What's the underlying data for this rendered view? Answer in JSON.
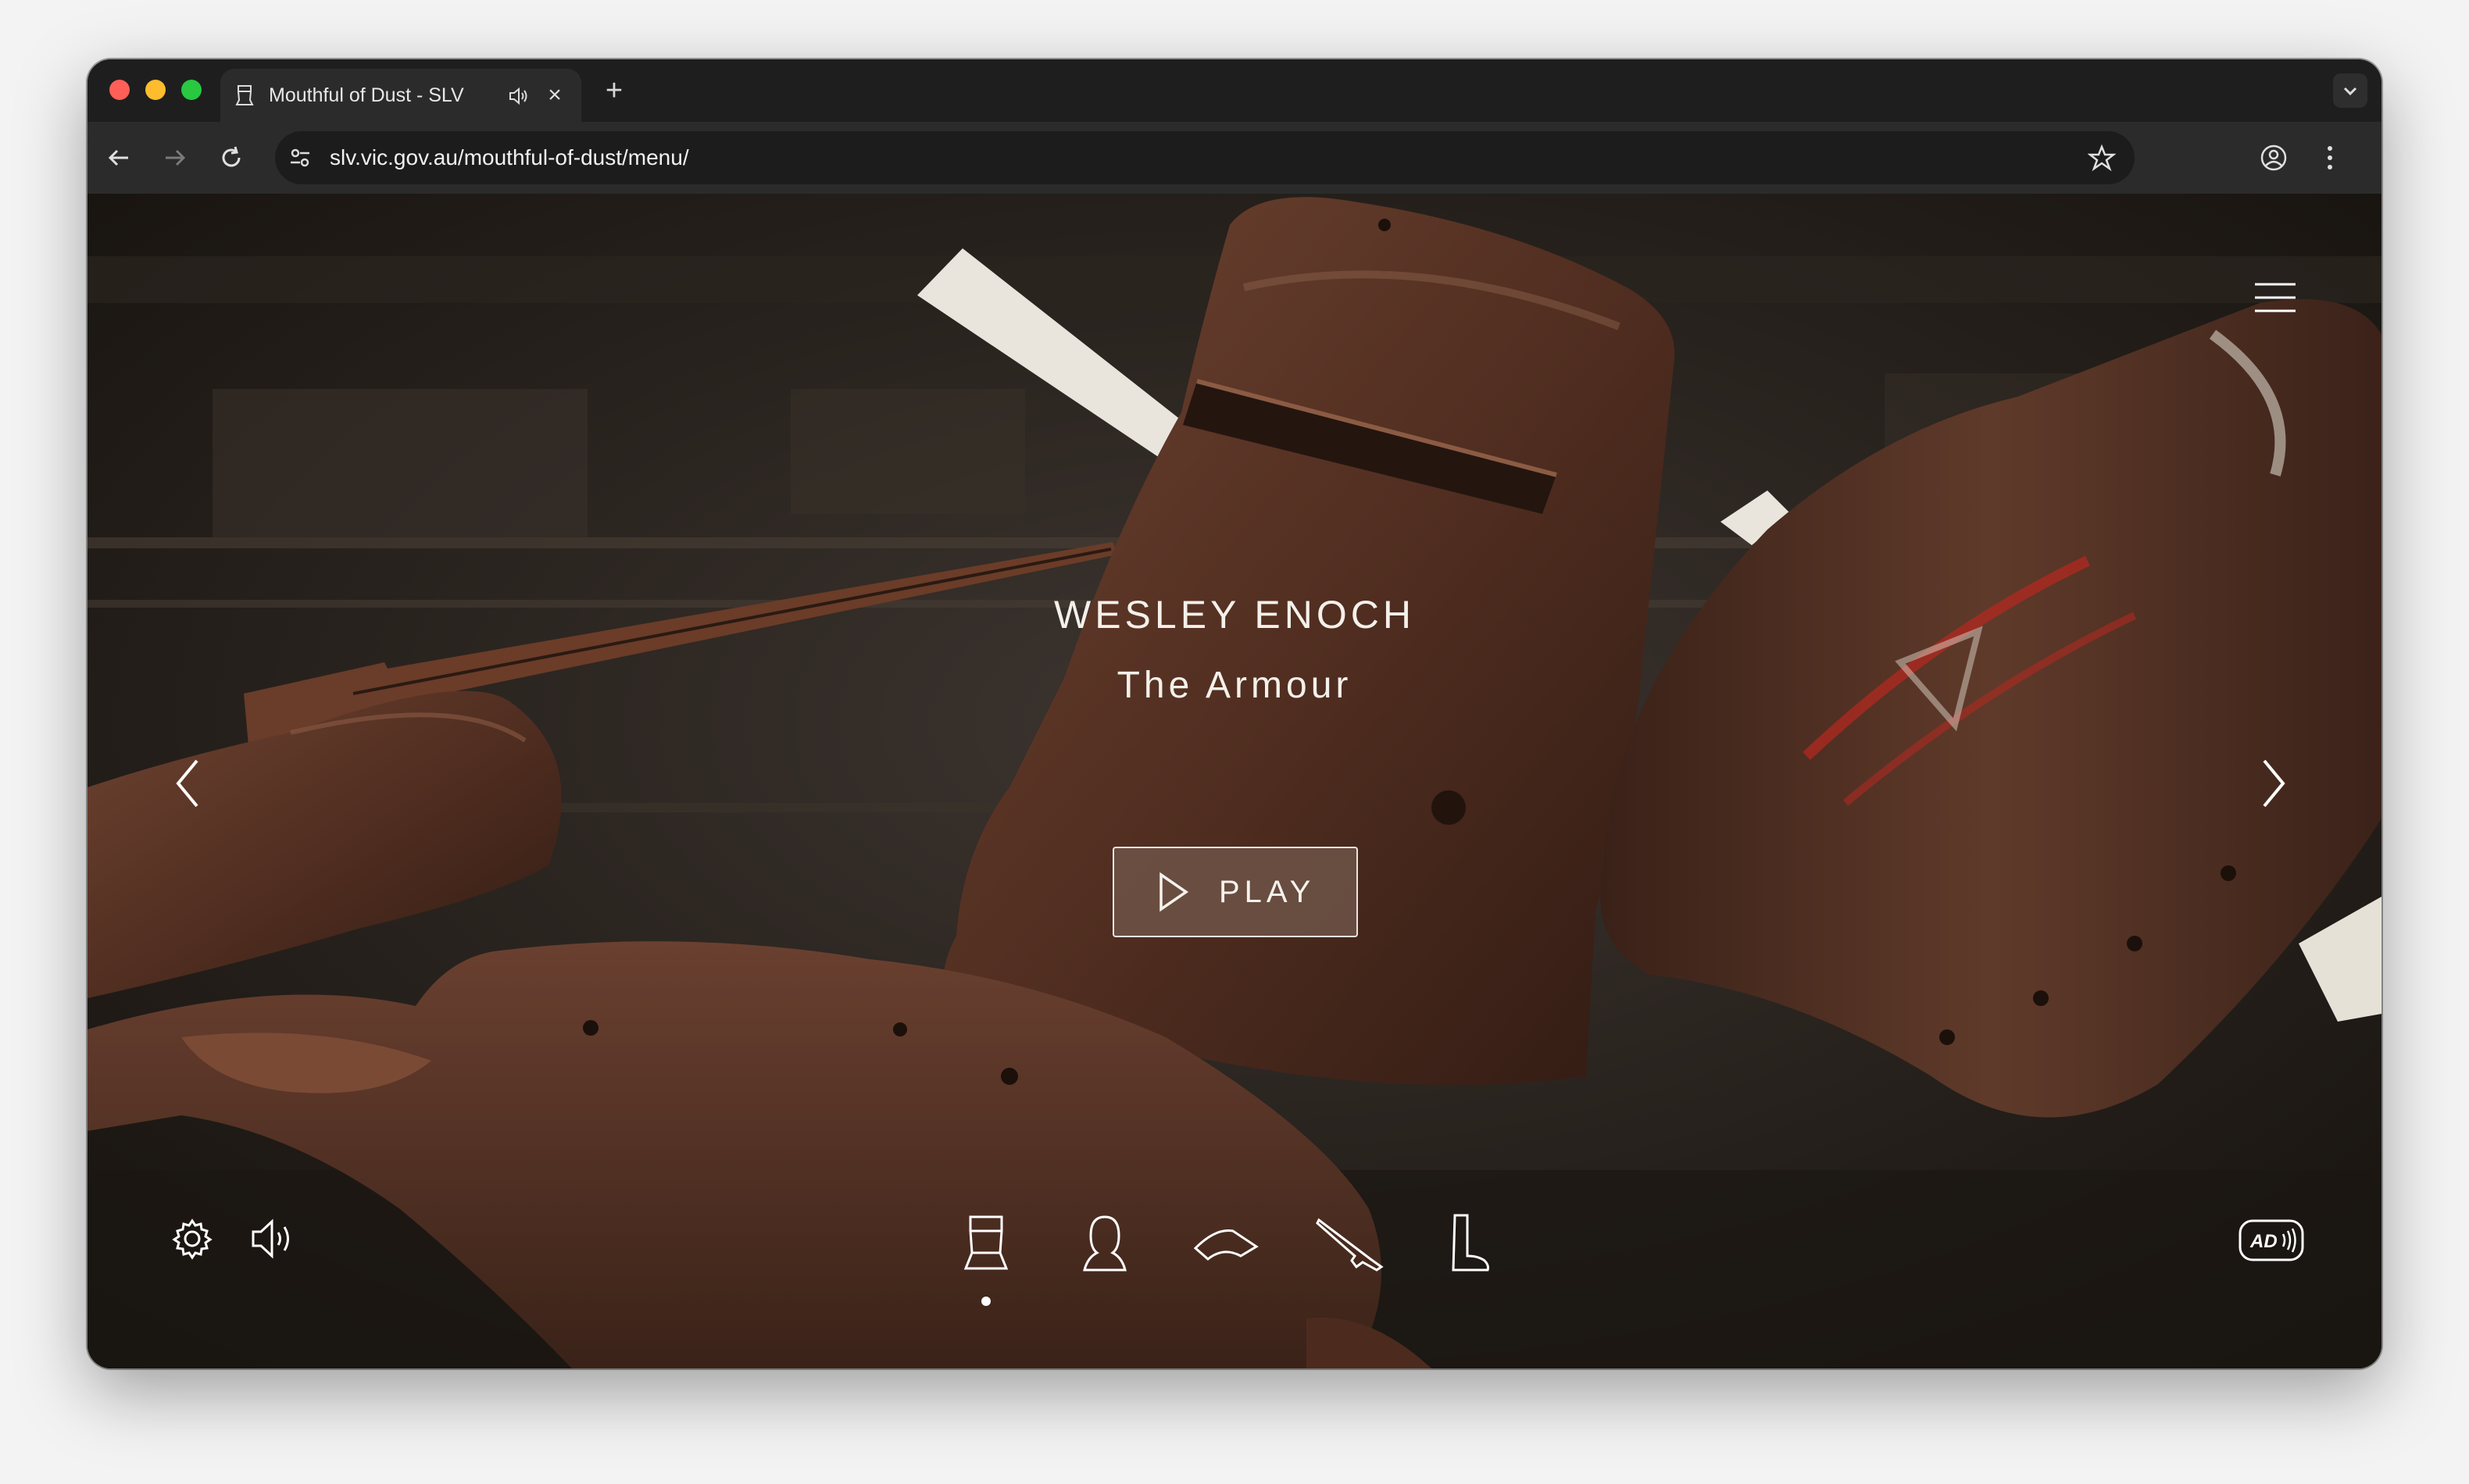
{
  "browser": {
    "tab": {
      "title": "Mouthful of Dust - SLV",
      "favicon": "helmet-icon",
      "audio": "speaker-icon"
    },
    "address_bar": {
      "url": "slv.vic.gov.au/mouthful-of-dust/menu/"
    }
  },
  "page": {
    "menu_icon": "hamburger-icon",
    "story": {
      "author": "WESLEY ENOCH",
      "title": "The Armour"
    },
    "play_button": {
      "label": "PLAY"
    },
    "controls": {
      "settings_icon": "gear-icon",
      "sound_icon": "volume-icon",
      "audio_description": "AD"
    },
    "chapters": [
      {
        "icon": "helmet-icon",
        "active": true
      },
      {
        "icon": "head-silhouette-icon",
        "active": false
      },
      {
        "icon": "shoulder-plate-icon",
        "active": false
      },
      {
        "icon": "rifle-icon",
        "active": false
      },
      {
        "icon": "boot-icon",
        "active": false
      }
    ],
    "colors": {
      "accent_text": "#f4f0ea",
      "rust": "#5a3423",
      "button_fill": "#6e5448"
    }
  }
}
